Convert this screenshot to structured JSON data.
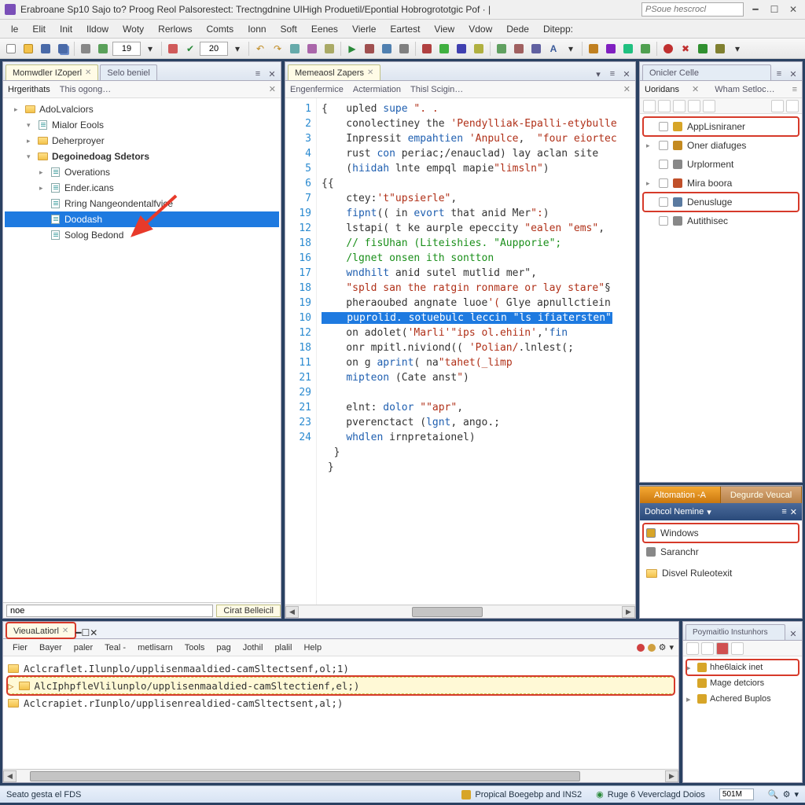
{
  "title_bar": {
    "title": "Erabroane Sp10 Sajo to? Proog Reol Palsorestect: Trectngdnine UIHigh Produetil/Epontial Hobrogrototgic Pof  · |",
    "search_placeholder": "PSoue hescrocl"
  },
  "main_menu": [
    "le",
    "Elit",
    "Init",
    "Ildow",
    "Woty",
    "Rerlows",
    "Comts",
    "Ionn",
    "Soft",
    "Eenes",
    "Vierle",
    "Eartest",
    "View",
    "Vdow",
    "Dede",
    "Ditepp:"
  ],
  "toolbar": {
    "num1": "19",
    "num2": "20"
  },
  "left": {
    "tabs": {
      "t1": "Momwdler IZoperl",
      "t2": "Selo beniel"
    },
    "sub_tabs": {
      "s1": "Hrgerithats",
      "s2": "This ogong…"
    },
    "tree": [
      {
        "lvl": 1,
        "arrow": "▸",
        "icon": "folder",
        "label": "AdoLvalciors"
      },
      {
        "lvl": 2,
        "arrow": "▾",
        "icon": "file",
        "label": "Mialor Eools"
      },
      {
        "lvl": 2,
        "arrow": "▸",
        "icon": "folder",
        "label": "Deherproyer"
      },
      {
        "lvl": 2,
        "arrow": "▾",
        "icon": "folder",
        "label": "Degoinedoag Sdetors",
        "bold": true
      },
      {
        "lvl": 3,
        "arrow": "▸",
        "icon": "file",
        "label": "Overations"
      },
      {
        "lvl": 3,
        "arrow": "▸",
        "icon": "file",
        "label": "Ender.icans"
      },
      {
        "lvl": 3,
        "arrow": "",
        "icon": "file",
        "label": "Rring Nangeondentalfvice"
      },
      {
        "lvl": 3,
        "arrow": "",
        "icon": "file",
        "label": "Doodash",
        "sel": true
      },
      {
        "lvl": 3,
        "arrow": "",
        "icon": "file",
        "label": "Solog Bedond"
      }
    ],
    "status_input": "noe",
    "status_chip": "Cirat Belleicil"
  },
  "editor": {
    "tab": "Memeaosl Zapers",
    "sub_tabs": {
      "a": "Engenfermice",
      "b": "Actermiation",
      "c": "Thisl Scigin…"
    },
    "gutter": [
      "1",
      "2",
      "3",
      "4",
      "5",
      "",
      "6",
      "7",
      "19",
      "12",
      "18",
      "16",
      "17",
      "18",
      "19",
      "10",
      "12",
      "18",
      "11",
      "21",
      "",
      "29",
      "21",
      "23",
      "24"
    ]
  },
  "right_top": {
    "title_tab": "Onicler Celle",
    "sub_tabs": {
      "a": "Uoridans",
      "b": "Wham Setloc…"
    },
    "items": [
      {
        "arrow": "",
        "label": "AppLisniraner",
        "hl": true,
        "icon": "#d7a528"
      },
      {
        "arrow": "▸",
        "label": "Oner diafuges",
        "icon": "#c48a20"
      },
      {
        "arrow": "",
        "label": "Urplorment",
        "icon": "#888"
      },
      {
        "arrow": "▸",
        "label": "Mira boora",
        "icon": "#c0502a"
      },
      {
        "arrow": "",
        "label": "Denusluge",
        "hl": true,
        "icon": "#5a7aa0"
      },
      {
        "arrow": "",
        "label": "Autithisec",
        "icon": "#888"
      }
    ]
  },
  "right_mid": {
    "tabs": {
      "a": "Altomation -A",
      "b": "Degurde Veucal"
    },
    "title": "Dohcol Nemine",
    "items": [
      {
        "label": "Windows",
        "hl": true,
        "icon": "#d7a528"
      },
      {
        "label": "Saranchr",
        "icon": "#888"
      }
    ],
    "extra": "Disvel Ruleotexit"
  },
  "console": {
    "tab": "VieuaLatiorl",
    "menu": [
      "Fier",
      "Bayer",
      "paler",
      "Teal -",
      "metlisarn",
      "Tools",
      "pag",
      "Jothil",
      "plalil",
      "Help"
    ],
    "lines": [
      {
        "text": "Aclcraflet.Ilunplo/upplisenmaaldied-camSltectsenf,ol;1)",
        "prompt": false,
        "hl": false
      },
      {
        "text": "AlcIphpfleVlilunplo/upplisenmaaldied-camSltectienf,el;)",
        "prompt": true,
        "hl": true
      },
      {
        "text": "Aclcrapiet.rIunplo/upplisenrealdied-camSltectsent,al;)",
        "prompt": false,
        "hl": false
      }
    ]
  },
  "right_lower": {
    "title": "Poymaitlio Instunhors",
    "items": [
      {
        "arrow": "▸",
        "label": "hhe6laick inet",
        "hl": true
      },
      {
        "arrow": "",
        "label": "Mage detciors"
      },
      {
        "arrow": "▸",
        "label": "Achered Buplos"
      }
    ]
  },
  "status_bar": {
    "left": "Seato gesta el FDS",
    "mid1": "Propical Boegebp and INS2",
    "mid2": "Ruge 6 Veverclagd Doios",
    "input": "501M"
  }
}
